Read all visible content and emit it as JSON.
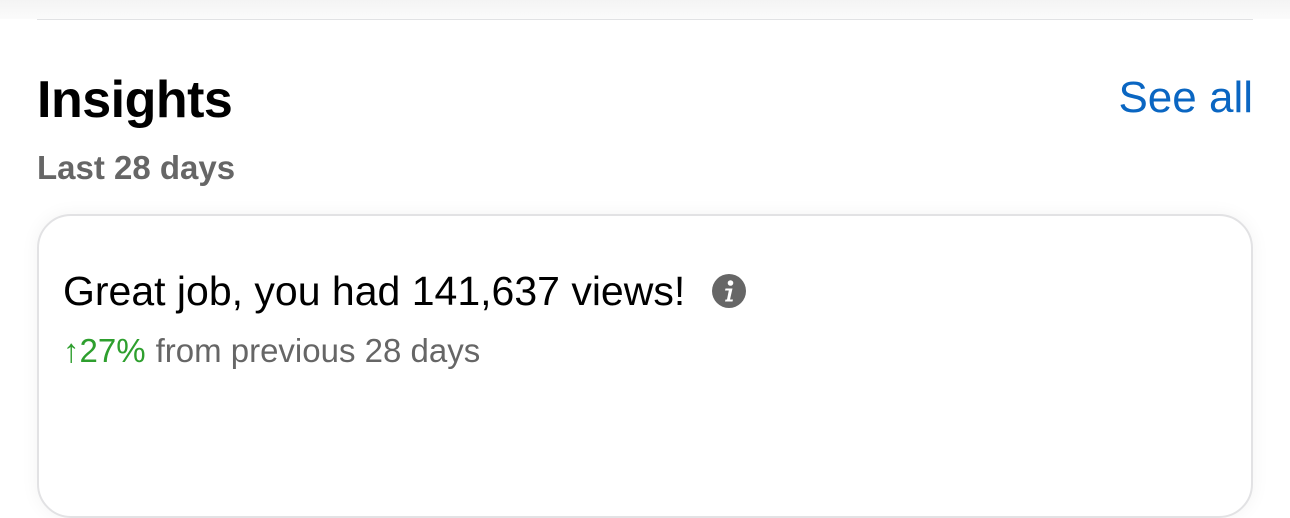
{
  "insights": {
    "title": "Insights",
    "see_all_label": "See all",
    "period": "Last 28 days",
    "card": {
      "headline": "Great job, you had 141,637 views!",
      "info_icon": "info-icon",
      "change_arrow": "↑",
      "change_value": "27%",
      "change_text": "from previous 28 days"
    }
  },
  "colors": {
    "link": "#0a66c2",
    "positive": "#2e9f2e",
    "secondary_text": "#666666"
  }
}
